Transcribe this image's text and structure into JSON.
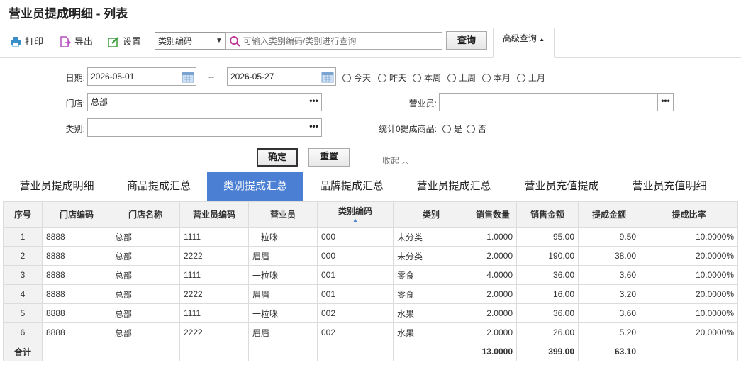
{
  "page": {
    "title": "营业员提成明细 - 列表"
  },
  "toolbar": {
    "print_label": "打印",
    "export_label": "导出",
    "settings_label": "设置",
    "search_field_selected": "类别编码",
    "search_placeholder": "可输入类别编码/类别进行查询",
    "query_label": "查询",
    "advanced_label": "高级查询"
  },
  "filter": {
    "date_label": "日期:",
    "date_from": "2026-05-01",
    "date_sep": "--",
    "date_to": "2026-05-27",
    "quick_dates": [
      "今天",
      "昨天",
      "本周",
      "上周",
      "本月",
      "上月"
    ],
    "store_label": "门店:",
    "store_value": "总部",
    "salesperson_label": "营业员:",
    "salesperson_value": "",
    "category_label": "类别:",
    "category_value": "",
    "zero_label": "统计0提成商品:",
    "zero_options": [
      "是",
      "否"
    ],
    "confirm_label": "确定",
    "reset_label": "重置",
    "collapse_label": "收起"
  },
  "tabs": [
    "营业员提成明细",
    "商品提成汇总",
    "类别提成汇总",
    "品牌提成汇总",
    "营业员提成汇总",
    "营业员充值提成",
    "营业员充值明细"
  ],
  "active_tab": 2,
  "accent_color": "#4a7fd4",
  "table": {
    "headers": [
      "序号",
      "门店编码",
      "门店名称",
      "营业员编码",
      "营业员",
      "类别编码",
      "类别",
      "销售数量",
      "销售金额",
      "提成金额",
      "提成比率"
    ],
    "rows": [
      [
        "1",
        "8888",
        "总部",
        "1111",
        "一粒咪",
        "000",
        "未分类",
        "1.0000",
        "95.00",
        "9.50",
        "10.0000%"
      ],
      [
        "2",
        "8888",
        "总部",
        "2222",
        "眉眉",
        "000",
        "未分类",
        "2.0000",
        "190.00",
        "38.00",
        "20.0000%"
      ],
      [
        "3",
        "8888",
        "总部",
        "1111",
        "一粒咪",
        "001",
        "零食",
        "4.0000",
        "36.00",
        "3.60",
        "10.0000%"
      ],
      [
        "4",
        "8888",
        "总部",
        "2222",
        "眉眉",
        "001",
        "零食",
        "2.0000",
        "16.00",
        "3.20",
        "20.0000%"
      ],
      [
        "5",
        "8888",
        "总部",
        "1111",
        "一粒咪",
        "002",
        "水果",
        "2.0000",
        "36.00",
        "3.60",
        "10.0000%"
      ],
      [
        "6",
        "8888",
        "总部",
        "2222",
        "眉眉",
        "002",
        "水果",
        "2.0000",
        "26.00",
        "5.20",
        "20.0000%"
      ]
    ],
    "total_label": "合计",
    "total_qty": "13.0000",
    "total_amount": "399.00",
    "total_commission": "63.10"
  }
}
